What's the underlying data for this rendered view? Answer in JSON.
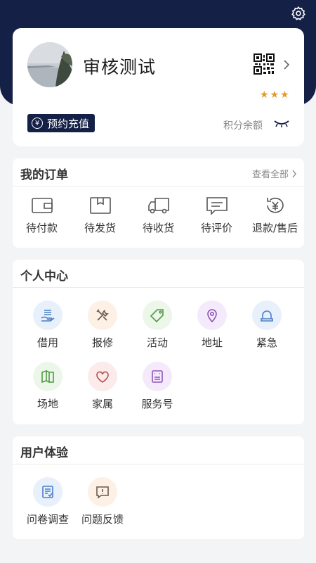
{
  "profile": {
    "username": "审核测试",
    "recharge_label": "预约充值",
    "points_label": "积分余额",
    "stars": 3
  },
  "orders": {
    "title": "我的订单",
    "view_all": "查看全部",
    "items": [
      {
        "label": "待付款",
        "icon": "wallet-icon"
      },
      {
        "label": "待发货",
        "icon": "box-icon"
      },
      {
        "label": "待收货",
        "icon": "truck-icon"
      },
      {
        "label": "待评价",
        "icon": "comment-icon"
      },
      {
        "label": "退款/售后",
        "icon": "refund-icon"
      }
    ]
  },
  "personal": {
    "title": "个人中心",
    "items": [
      {
        "label": "借用",
        "icon": "hand-icon"
      },
      {
        "label": "报修",
        "icon": "tools-icon"
      },
      {
        "label": "活动",
        "icon": "tag-icon"
      },
      {
        "label": "地址",
        "icon": "location-icon"
      },
      {
        "label": "紧急",
        "icon": "alarm-icon"
      },
      {
        "label": "场地",
        "icon": "venue-icon"
      },
      {
        "label": "家属",
        "icon": "heart-icon"
      },
      {
        "label": "服务号",
        "icon": "service-icon"
      }
    ]
  },
  "experience": {
    "title": "用户体验",
    "items": [
      {
        "label": "问卷调查",
        "icon": "survey-icon"
      },
      {
        "label": "问题反馈",
        "icon": "feedback-icon"
      }
    ]
  },
  "colors": {
    "header_bg": "#142046",
    "star": "#e39a2a"
  }
}
